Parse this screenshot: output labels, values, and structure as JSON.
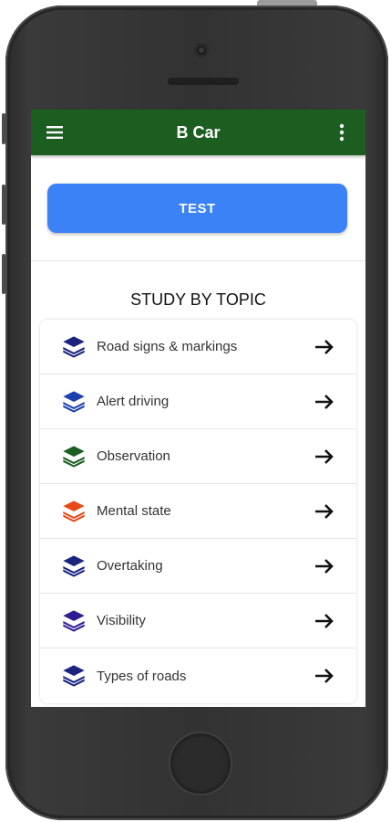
{
  "app_bar": {
    "title": "B Car",
    "menu_icon": "menu-icon",
    "more_icon": "more-vert-icon",
    "background": "#1b5e20"
  },
  "test_button": {
    "label": "TEST",
    "color": "#3b82f6"
  },
  "study_section": {
    "title": "STUDY BY TOPIC",
    "topics": [
      {
        "label": "Road signs & markings",
        "icon": "layers-icon",
        "icon_color": "#1a237e"
      },
      {
        "label": "Alert driving",
        "icon": "layers-icon",
        "icon_color": "#1e40af"
      },
      {
        "label": "Observation",
        "icon": "layers-icon",
        "icon_color": "#1b5e20"
      },
      {
        "label": "Mental state",
        "icon": "layers-icon",
        "icon_color": "#e64a19"
      },
      {
        "label": "Overtaking",
        "icon": "layers-icon",
        "icon_color": "#1a237e"
      },
      {
        "label": "Visibility",
        "icon": "layers-icon",
        "icon_color": "#311b92"
      },
      {
        "label": "Types of roads",
        "icon": "layers-icon",
        "icon_color": "#1a237e"
      }
    ],
    "arrow_icon": "arrow-right-icon"
  }
}
